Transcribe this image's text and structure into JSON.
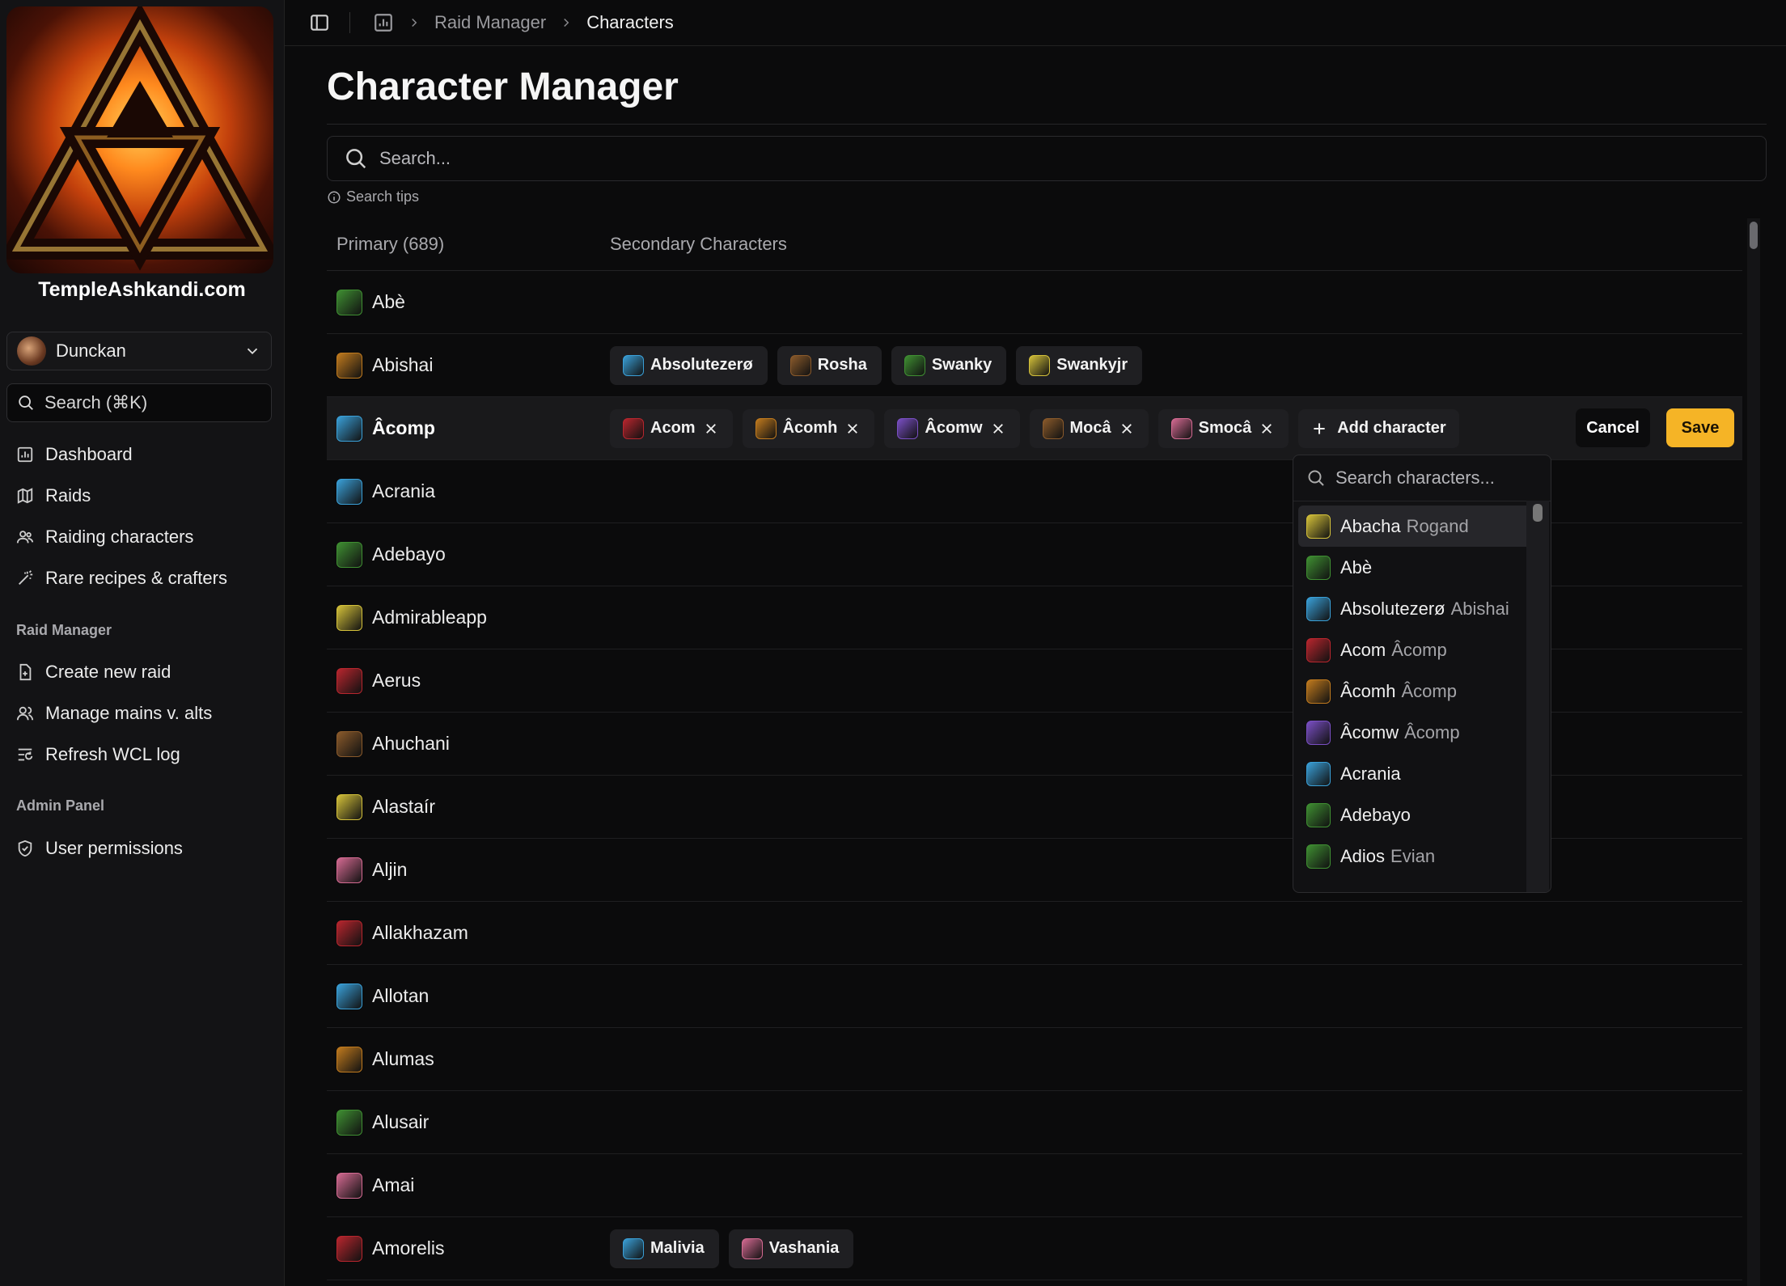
{
  "sidebar": {
    "site_name": "TempleAshkandi.com",
    "user": "Dunckan",
    "search_placeholder": "Search (⌘K)",
    "nav": [
      {
        "label": "Dashboard",
        "icon": "chart-icon"
      },
      {
        "label": "Raids",
        "icon": "map-icon"
      },
      {
        "label": "Raiding characters",
        "icon": "users-icon"
      },
      {
        "label": "Rare recipes & crafters",
        "icon": "wand-icon"
      }
    ],
    "raid_manager_label": "Raid Manager",
    "raid_manager": [
      {
        "label": "Create new raid",
        "icon": "file-plus-icon"
      },
      {
        "label": "Manage mains v. alts",
        "icon": "user-group-icon"
      },
      {
        "label": "Refresh WCL log",
        "icon": "list-refresh-icon"
      }
    ],
    "admin_label": "Admin Panel",
    "admin": [
      {
        "label": "User permissions",
        "icon": "shield-icon"
      }
    ]
  },
  "breadcrumb": {
    "items": [
      "Raid Manager",
      "Characters"
    ]
  },
  "page": {
    "title": "Character Manager",
    "search_placeholder": "Search...",
    "search_tips": "Search tips",
    "primary_header": "Primary (689)",
    "secondary_header": "Secondary Characters",
    "add_character": "Add character",
    "cancel": "Cancel",
    "save": "Save"
  },
  "class_colors": {
    "hunter": "#3f8f32",
    "druid": "#c07a1e",
    "rogue": "#d4c13a",
    "warrior": "#8a5a2b",
    "mage": "#3aa0d8",
    "paladin": "#d46a92",
    "warlock": "#7a4fc4",
    "priest": "#d8d8d8",
    "shaman": "#2a6fd6",
    "deathknight": "#b8262e"
  },
  "rows": [
    {
      "primary": "Abè",
      "cls": "hunter",
      "secondary": []
    },
    {
      "primary": "Abishai",
      "cls": "druid",
      "secondary": [
        {
          "name": "Absolutezerø",
          "cls": "mage"
        },
        {
          "name": "Rosha",
          "cls": "warrior"
        },
        {
          "name": "Swanky",
          "cls": "hunter"
        },
        {
          "name": "Swankyjr",
          "cls": "rogue"
        }
      ]
    },
    {
      "primary": "Âcomp",
      "cls": "mage",
      "active": true,
      "secondary": [
        {
          "name": "Acom",
          "cls": "deathknight"
        },
        {
          "name": "Âcomh",
          "cls": "druid"
        },
        {
          "name": "Âcomw",
          "cls": "warlock"
        },
        {
          "name": "Mocâ",
          "cls": "warrior"
        },
        {
          "name": "Smocâ",
          "cls": "paladin"
        }
      ]
    },
    {
      "primary": "Acrania",
      "cls": "mage",
      "secondary": []
    },
    {
      "primary": "Adebayo",
      "cls": "hunter",
      "secondary": []
    },
    {
      "primary": "Admirableapp",
      "cls": "rogue",
      "secondary": []
    },
    {
      "primary": "Aerus",
      "cls": "deathknight",
      "secondary": []
    },
    {
      "primary": "Ahuchani",
      "cls": "warrior",
      "secondary": []
    },
    {
      "primary": "Alastaír",
      "cls": "rogue",
      "secondary": []
    },
    {
      "primary": "Aljin",
      "cls": "paladin",
      "secondary": []
    },
    {
      "primary": "Allakhazam",
      "cls": "deathknight",
      "secondary": []
    },
    {
      "primary": "Allotan",
      "cls": "mage",
      "secondary": []
    },
    {
      "primary": "Alumas",
      "cls": "druid",
      "secondary": []
    },
    {
      "primary": "Alusair",
      "cls": "hunter",
      "secondary": []
    },
    {
      "primary": "Amai",
      "cls": "paladin",
      "secondary": []
    },
    {
      "primary": "Amorelis",
      "cls": "deathknight",
      "secondary": [
        {
          "name": "Malivia",
          "cls": "mage"
        },
        {
          "name": "Vashania",
          "cls": "paladin"
        }
      ]
    }
  ],
  "dropdown": {
    "search_placeholder": "Search characters...",
    "items": [
      {
        "name": "Abacha",
        "sub": "Rogand",
        "cls": "rogue",
        "highlighted": true
      },
      {
        "name": "Abè",
        "sub": "",
        "cls": "hunter"
      },
      {
        "name": "Absolutezerø",
        "sub": "Abishai",
        "cls": "mage"
      },
      {
        "name": "Acom",
        "sub": "Âcomp",
        "cls": "deathknight"
      },
      {
        "name": "Âcomh",
        "sub": "Âcomp",
        "cls": "druid"
      },
      {
        "name": "Âcomw",
        "sub": "Âcomp",
        "cls": "warlock"
      },
      {
        "name": "Acrania",
        "sub": "",
        "cls": "mage"
      },
      {
        "name": "Adebayo",
        "sub": "",
        "cls": "hunter"
      },
      {
        "name": "Adios",
        "sub": "Evian",
        "cls": "hunter"
      }
    ]
  }
}
